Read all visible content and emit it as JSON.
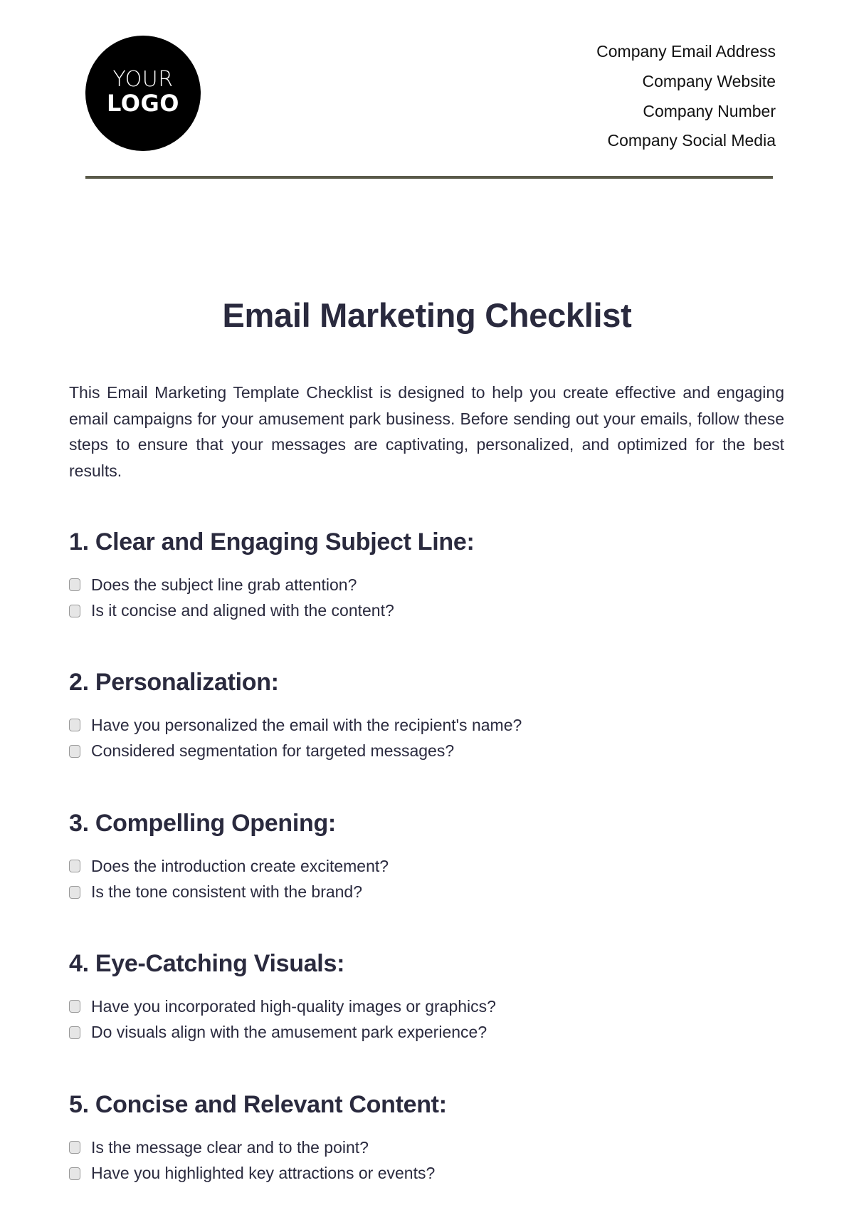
{
  "header": {
    "logo": {
      "line1": "YOUR",
      "line2": "LOGO"
    },
    "contact": [
      "Company Email Address",
      "Company Website",
      "Company Number",
      "Company Social Media"
    ]
  },
  "document": {
    "title": "Email Marketing Checklist",
    "intro": "This Email Marketing Template Checklist is designed to help you create effective and engaging email campaigns for your amusement park business. Before sending out your emails, follow these steps to ensure that your messages are captivating, personalized, and optimized for the best results.",
    "sections": [
      {
        "heading": "1. Clear and Engaging Subject Line:",
        "items": [
          "Does the subject line grab attention?",
          "Is it concise and aligned with the content?"
        ]
      },
      {
        "heading": "2. Personalization:",
        "items": [
          "Have you personalized the email with the recipient's name?",
          "Considered segmentation for targeted messages?"
        ]
      },
      {
        "heading": "3. Compelling Opening:",
        "items": [
          "Does the introduction create excitement?",
          "Is the tone consistent with the brand?"
        ]
      },
      {
        "heading": "4. Eye-Catching Visuals:",
        "items": [
          "Have you incorporated high-quality images or graphics?",
          "Do visuals align with the amusement park experience?"
        ]
      },
      {
        "heading": "5. Concise and Relevant Content:",
        "items": [
          "Is the message clear and to the point?",
          "Have you highlighted key attractions or events?"
        ]
      }
    ]
  }
}
